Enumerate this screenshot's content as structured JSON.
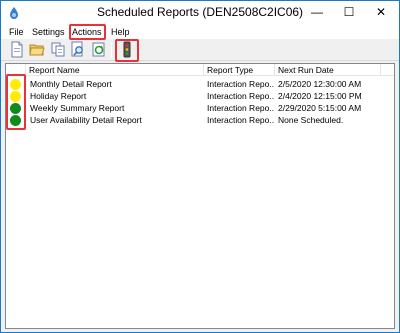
{
  "window": {
    "title": "Scheduled Reports (DEN2508C2IC06)",
    "controls": {
      "minimize": "—",
      "maximize": "☐",
      "close": "✕"
    }
  },
  "menubar": {
    "items": [
      {
        "label": "File"
      },
      {
        "label": "Settings"
      },
      {
        "label": "Actions"
      },
      {
        "label": "Help"
      }
    ]
  },
  "toolbar": {
    "buttons": [
      {
        "icon": "new-report-icon"
      },
      {
        "icon": "open-folder-icon"
      },
      {
        "icon": "copy-icon"
      },
      {
        "icon": "search-document-icon"
      },
      {
        "icon": "refresh-icon"
      },
      {
        "icon": "run-status-icon"
      }
    ]
  },
  "list": {
    "columns": [
      {
        "label": "Report Name"
      },
      {
        "label": "Report Type"
      },
      {
        "label": "Next Run Date"
      }
    ],
    "rows": [
      {
        "status": "yellow",
        "name": "Monthly Detail Report",
        "type": "Interaction Repo...",
        "next_run": "2/5/2020 12:30:00 AM"
      },
      {
        "status": "yellow",
        "name": "Holiday Report",
        "type": "Interaction Repo...",
        "next_run": "2/4/2020 12:15:00 PM"
      },
      {
        "status": "green",
        "name": "Weekly Summary Report",
        "type": "Interaction Repo...",
        "next_run": "2/29/2020 5:15:00 AM"
      },
      {
        "status": "green",
        "name": "User Availability Detail Report",
        "type": "Interaction Repo...",
        "next_run": "None Scheduled."
      }
    ]
  },
  "colors": {
    "status_yellow": "#ffee00",
    "status_green": "#0f8a1d",
    "highlight": "#e8323a"
  }
}
